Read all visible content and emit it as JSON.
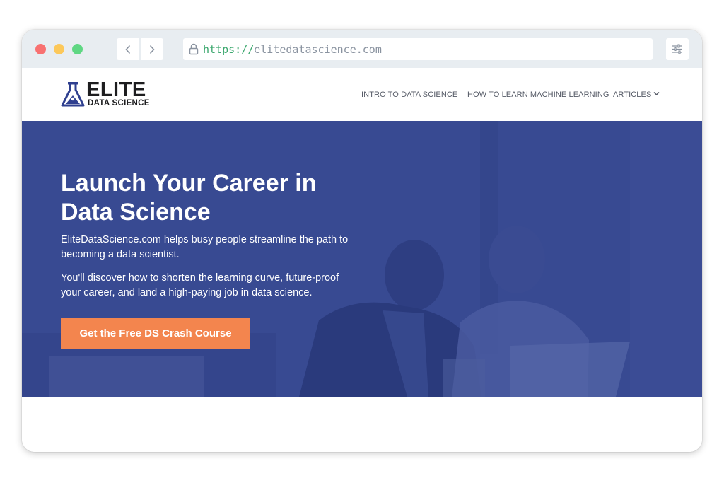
{
  "browser": {
    "back_icon": "chevron-left-icon",
    "forward_icon": "chevron-right-icon",
    "lock_icon": "lock-icon",
    "url_scheme": "https://",
    "url_host": "elitedatascience.com",
    "settings_icon": "sliders-icon"
  },
  "site": {
    "logo_title": "ELITE",
    "logo_subtitle": "DATA SCIENCE",
    "nav": {
      "intro": "INTRO TO DATA SCIENCE",
      "ml": "HOW TO LEARN MACHINE LEARNING",
      "articles": "ARTICLES"
    }
  },
  "hero": {
    "title": "Launch Your Career in Data Science",
    "paragraph1": "EliteDataScience.com helps busy people streamline the path to becoming a data scientist.",
    "paragraph2": "You'll discover how to shorten the learning curve, future-proof your career, and land a high-paying job in data science.",
    "cta_label": "Get the Free DS Crash Course"
  },
  "colors": {
    "hero_overlay": "#384a92",
    "cta": "#f3854e",
    "url_scheme": "#3aa76d",
    "logo_flask": "#2f3f8f"
  }
}
